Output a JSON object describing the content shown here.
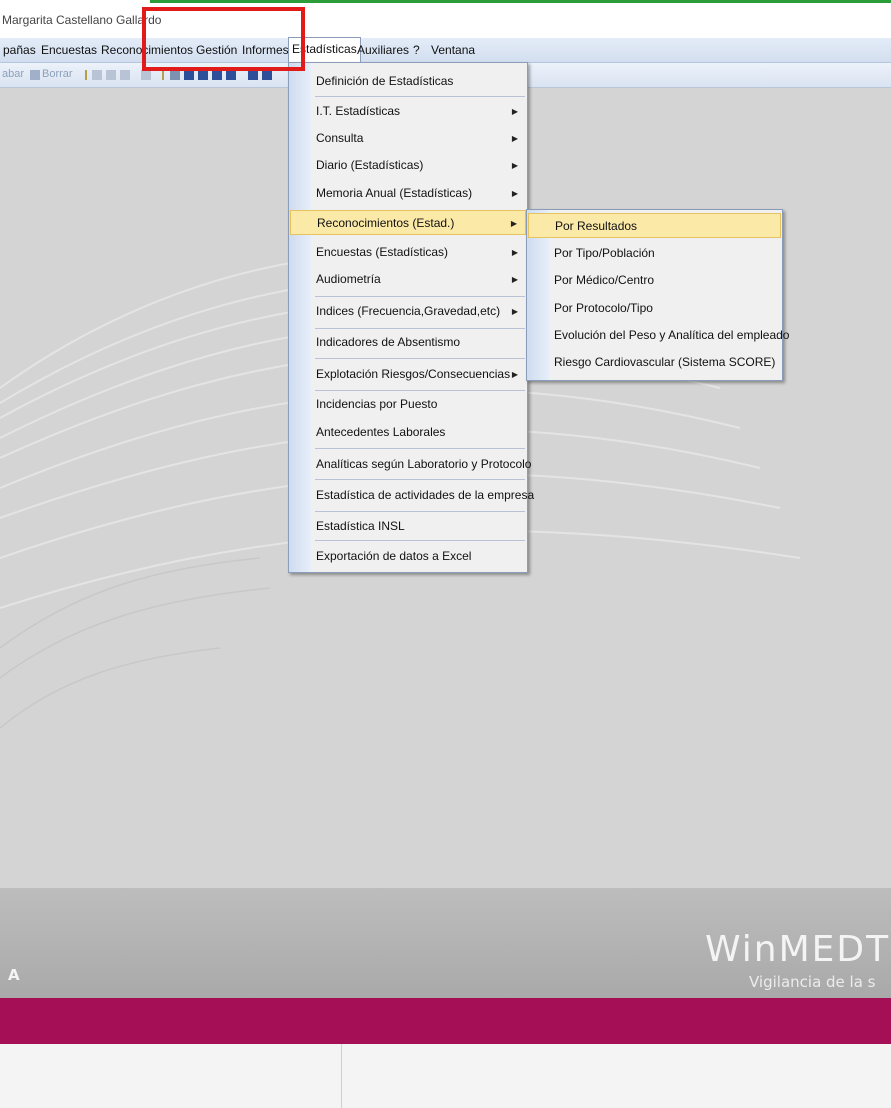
{
  "window": {
    "title": "Margarita Castellano Gallardo"
  },
  "menubar": [
    "pañas",
    "Encuestas",
    "Reconocimientos",
    "Gestión",
    "Informes",
    "Estadísticas",
    "Auxiliares",
    "?",
    "Ventana"
  ],
  "toolbar": {
    "grabar_label": "abar",
    "borrar_label": "Borrar"
  },
  "estadisticas_menu": [
    {
      "label": "Definición de Estadísticas",
      "submenu": false
    },
    {
      "label": "I.T. Estadísticas",
      "submenu": true
    },
    {
      "label": "Consulta",
      "submenu": true
    },
    {
      "label": "Diario (Estadísticas)",
      "submenu": true
    },
    {
      "label": "Memoria Anual (Estadísticas)",
      "submenu": true
    },
    {
      "label": "Reconocimientos (Estad.)",
      "submenu": true,
      "highlighted": true
    },
    {
      "label": "Encuestas (Estadísticas)",
      "submenu": true
    },
    {
      "label": "Audiometría",
      "submenu": true
    },
    {
      "label": "Indices (Frecuencia,Gravedad,etc)",
      "submenu": true
    },
    {
      "label": "Indicadores de Absentismo",
      "submenu": false
    },
    {
      "label": "Explotación Riesgos/Consecuencias",
      "submenu": true
    },
    {
      "label": "Incidencias por Puesto",
      "submenu": false
    },
    {
      "label": "Antecedentes Laborales",
      "submenu": false
    },
    {
      "label": "Analíticas según Laboratorio y Protocolo",
      "submenu": false
    },
    {
      "label": "Estadística de actividades de la empresa",
      "submenu": false
    },
    {
      "label": "Estadística INSL",
      "submenu": false
    },
    {
      "label": "Exportación de datos a Excel",
      "submenu": false
    }
  ],
  "reconocimientos_submenu": [
    {
      "label": "Por Resultados",
      "highlighted": true
    },
    {
      "label": "Por Tipo/Población"
    },
    {
      "label": "Por Médico/Centro"
    },
    {
      "label": "Por Protocolo/Tipo"
    },
    {
      "label": "Evolución del Peso y Analítica del empleado"
    },
    {
      "label": "Riesgo Cardiovascular (Sistema SCORE)"
    }
  ],
  "branding": {
    "name": "WinMEDT",
    "tagline": "Vigilancia de la s",
    "left_letter": "A"
  },
  "colors": {
    "highlight": "#fbe9a8",
    "footer_bar": "#a50f55",
    "annotation_box": "#e11a1a"
  }
}
